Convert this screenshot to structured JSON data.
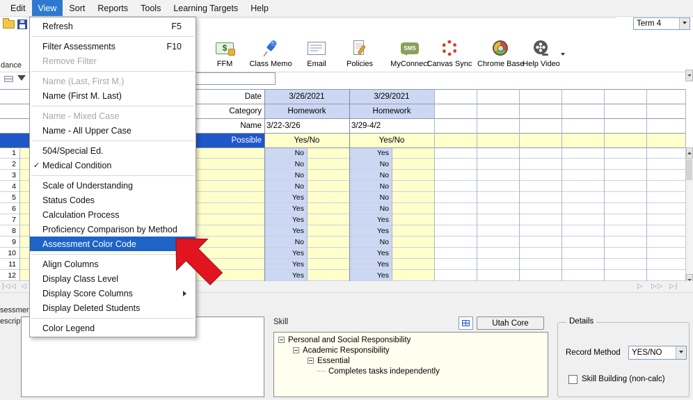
{
  "colors": {
    "menu_highlight": "#1e63c6",
    "selected_row_header": "#2057c8",
    "score_column": "#ccd8f3",
    "student_area": "#ffffcc",
    "callout_arrow": "#e0151f"
  },
  "icons": {
    "check": "✓",
    "dollar": "$",
    "nav_first": "|◁◁",
    "nav_prev": "◁",
    "nav_next": "▷",
    "nav_next_group": "▷▷",
    "nav_last": "▷|"
  },
  "menubar": {
    "items": [
      "Edit",
      "View",
      "Sort",
      "Reports",
      "Tools",
      "Learning Targets",
      "Help"
    ],
    "active": "View"
  },
  "view_menu": {
    "items": [
      {
        "label": "Refresh",
        "shortcut": "F5"
      },
      {
        "label": "Filter Assessments",
        "shortcut": "F10"
      },
      {
        "label": "Remove Filter"
      },
      {
        "label": "Name (Last, First M.)"
      },
      {
        "label": "Name (First M. Last)"
      },
      {
        "label": "Name - Mixed Case"
      },
      {
        "label": "Name - All Upper Case"
      },
      {
        "label": "504/Special Ed."
      },
      {
        "label": "Medical Condition"
      },
      {
        "label": "Scale of Understanding"
      },
      {
        "label": "Status Codes"
      },
      {
        "label": "Calculation Process"
      },
      {
        "label": "Proficiency Comparison by Method"
      },
      {
        "label": "Assessment Color Code"
      },
      {
        "label": "Align Columns"
      },
      {
        "label": "Display Class Level"
      },
      {
        "label": "Display Score Columns"
      },
      {
        "label": "Display Deleted Students"
      },
      {
        "label": "Color Legend"
      }
    ]
  },
  "toolbar": {
    "buttons": [
      {
        "label": "FFM"
      },
      {
        "label": "Class Memo"
      },
      {
        "label": "Email"
      },
      {
        "label": "Policies"
      },
      {
        "label": "MyConnect",
        "icon_text": "SMS"
      },
      {
        "label": "Canvas Sync"
      },
      {
        "label": "Chrome Base"
      },
      {
        "label": "Help Video"
      }
    ],
    "term_selector": "Term 4"
  },
  "fragments": {
    "attendance": "dance",
    "assessment_line1": "sessment",
    "assessment_line2": "escription"
  },
  "grid": {
    "row_labels": [
      "Date",
      "Category",
      "Name",
      "Possible"
    ],
    "assessments": [
      {
        "date": "3/26/2021",
        "category": "Homework",
        "name": "3/22-3/26",
        "possible": "Yes/No"
      },
      {
        "date": "3/29/2021",
        "category": "Homework",
        "name": "3/29-4/2",
        "possible": "Yes/No"
      }
    ],
    "rows": [
      {
        "num": "1",
        "c1": "No",
        "c2": "Yes"
      },
      {
        "num": "2",
        "c1": "No",
        "c2": "No"
      },
      {
        "num": "3",
        "c1": "No",
        "c2": "No"
      },
      {
        "num": "4",
        "c1": "No",
        "c2": "No"
      },
      {
        "num": "5",
        "c1": "Yes",
        "c2": "No"
      },
      {
        "num": "6",
        "c1": "Yes",
        "c2": "No"
      },
      {
        "num": "7",
        "c1": "Yes",
        "c2": "Yes"
      },
      {
        "num": "8",
        "c1": "Yes",
        "c2": "Yes"
      },
      {
        "num": "9",
        "c1": "No",
        "c2": "No"
      },
      {
        "num": "10",
        "c1": "Yes",
        "c2": "Yes"
      },
      {
        "num": "11",
        "c1": "Yes",
        "c2": "Yes"
      },
      {
        "num": "12",
        "c1": "Yes",
        "c2": "Yes"
      }
    ]
  },
  "bottom": {
    "skill_label": "Skill",
    "utah_core_button": "Utah Core",
    "tree": [
      "Personal and Social Responsibility",
      "Academic Responsibility",
      "Essential",
      "Completes tasks independently"
    ],
    "details": {
      "title": "Details",
      "record_method_label": "Record Method",
      "record_method_value": "YES/NO",
      "skill_building_label": "Skill Building (non-calc)"
    }
  }
}
